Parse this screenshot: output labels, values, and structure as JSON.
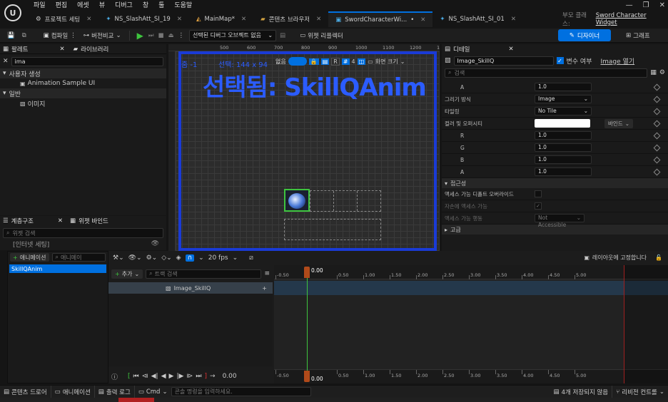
{
  "menu": [
    "파일",
    "편집",
    "에셋",
    "뷰",
    "디버그",
    "창",
    "툴",
    "도움말"
  ],
  "tabs": [
    {
      "label": "프로젝트 세팅",
      "icon": "gear-icon"
    },
    {
      "label": "NS_SlashAtt_SI_19",
      "icon": "niagara-icon"
    },
    {
      "label": "MainMap*",
      "icon": "level-icon"
    },
    {
      "label": "콘텐츠 브라우저",
      "icon": "folder-icon"
    },
    {
      "label": "SwordCharacterWi...",
      "icon": "widget-icon",
      "active": true
    },
    {
      "label": "NS_SlashAtt_SI_01",
      "icon": "niagara-icon"
    }
  ],
  "parent_class_label": "부모 클래스:",
  "parent_class_value": "Sword Character Widget",
  "toolbar": {
    "compile": "컴파일",
    "diff": "버전비교",
    "debug_object": "선택된 디버그 오브젝트 없음",
    "widget_reflector": "위젯 리플렉터",
    "designer": "디자이너",
    "graph": "그래프"
  },
  "palette": {
    "title": "팔레트",
    "library_tab": "라이브러리",
    "search_value": "ima",
    "categories": [
      {
        "label": "사용자 생성",
        "items": [
          "Animation Sample UI"
        ]
      },
      {
        "label": "일반",
        "items": [
          "이미지"
        ]
      }
    ]
  },
  "hierarchy": {
    "title": "계층구조",
    "widget_bind_tab": "위젯 바인드",
    "search_placeholder": "위젯 검색",
    "root_item": "[인터넷 세팅]"
  },
  "canvas": {
    "zoom": "줌 -1",
    "selection_size": "선택: 144 x 94",
    "overlay_title": "선택됨: SkillQAnim",
    "none_label": "없음",
    "grid_number": "4",
    "r_label": "R",
    "screen_size": "화면 크기",
    "ruler_ticks": [
      "500",
      "600",
      "700",
      "800",
      "900",
      "1000",
      "1100",
      "1200",
      "1300",
      "1400",
      "1500"
    ]
  },
  "details": {
    "title": "디테일",
    "name_value": "Image_SkillQ",
    "is_variable_label": "변수 여부",
    "open_image": "Image 열기",
    "search_placeholder": "검색",
    "props": [
      {
        "label": "A",
        "type": "num",
        "value": "1.0",
        "indent": true
      },
      {
        "label": "그리기 방식",
        "type": "dropdown",
        "value": "Image"
      },
      {
        "label": "타일링",
        "type": "dropdown",
        "value": "No Tile"
      },
      {
        "label": "컬러 및 오퍼시티",
        "type": "color",
        "value": "바인드"
      },
      {
        "label": "R",
        "type": "num",
        "value": "1.0",
        "indent": true
      },
      {
        "label": "G",
        "type": "num",
        "value": "1.0",
        "indent": true
      },
      {
        "label": "B",
        "type": "num",
        "value": "1.0",
        "indent": true
      },
      {
        "label": "A",
        "type": "num",
        "value": "1.0",
        "indent": true
      }
    ],
    "accessibility_header": "접근성",
    "accessibility_props": [
      {
        "label": "액세스 가능 디폴트 오버라이드",
        "type": "checkbox",
        "checked": false
      },
      {
        "label": "자손에 액세스 가능",
        "type": "checkbox",
        "checked": true,
        "disabled": true
      },
      {
        "label": "액세스 가능 행동",
        "type": "dropdown",
        "value": "Not Accessible",
        "disabled": true
      }
    ],
    "next_header": "고급"
  },
  "animations": {
    "add_button": "애니메이션",
    "search_placeholder": "애니메이",
    "items": [
      "SkillQAnim"
    ]
  },
  "sequencer": {
    "fps": "20 fps",
    "lock_label": "레이아웃에 고정합니다",
    "add_button": "추가",
    "search_placeholder": "트랙 검색",
    "track_name": "Image_SkillQ",
    "time_value": "0.00",
    "time_display": "0.00",
    "ruler_ticks": [
      "-0.50",
      "0.50",
      "1.00",
      "1.50",
      "2.00",
      "2.50",
      "3.00",
      "3.50",
      "4.00",
      "4.50",
      "5.00"
    ]
  },
  "bottom": {
    "content_drawer": "콘텐츠 드로어",
    "animation": "애니메이션",
    "output_log": "출력 로그",
    "cmd": "Cmd",
    "console_placeholder": "콘솔 명령을 입력하세요.",
    "unsaved": "4개 저장되지 않음",
    "revision": "리비전 컨트롤"
  },
  "colors": {
    "accent": "#0070e0",
    "select": "#2b5cff",
    "green": "#3ec43e"
  }
}
